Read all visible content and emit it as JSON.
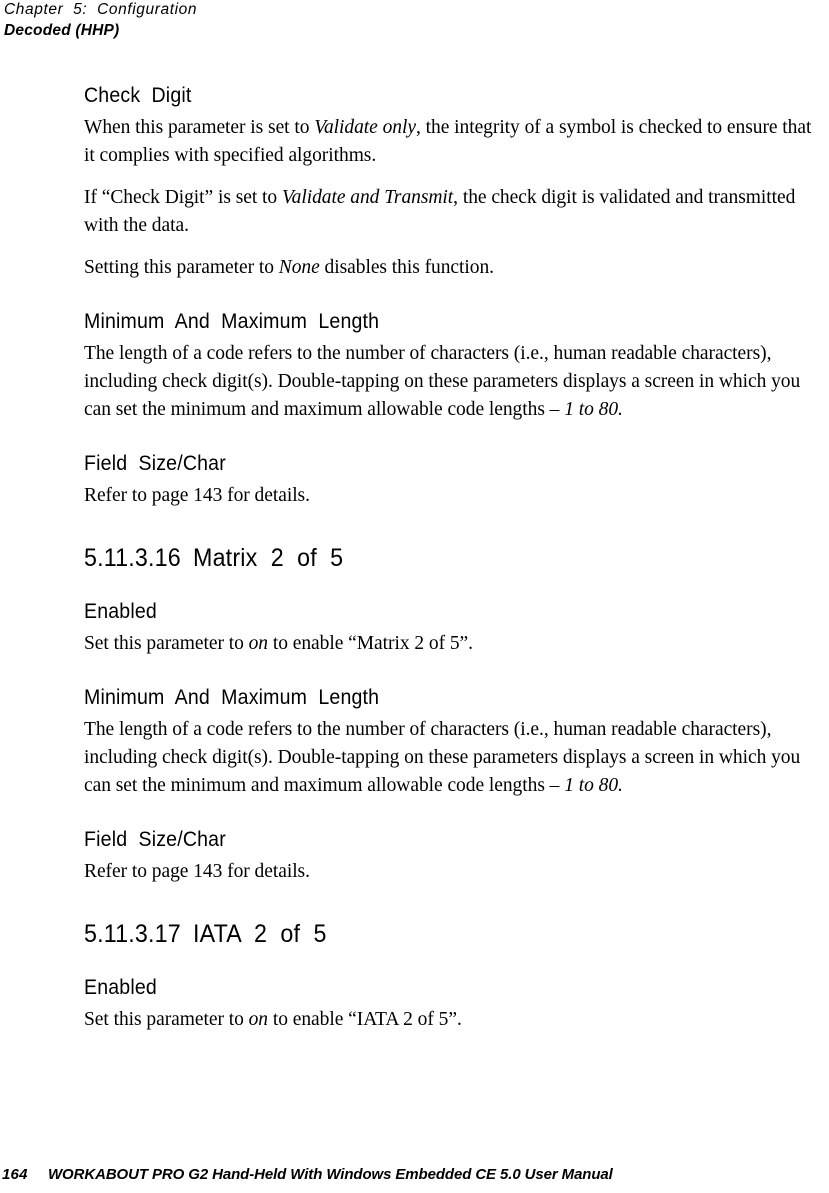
{
  "header": {
    "chapter": "Chapter  5:  Configuration",
    "section": "Decoded (HHP)"
  },
  "footer": {
    "page_number": "164",
    "manual_title": "WORKABOUT PRO G2 Hand-Held With Windows Embedded CE 5.0 User Manual"
  },
  "content": {
    "check_digit": {
      "heading": "Check  Digit",
      "p1_a": "When this parameter is set to ",
      "p1_em": "Validate only",
      "p1_b": ", the integrity of a symbol is checked to ensure that it complies with specified algorithms.",
      "p2_a": "If “Check Digit” is set to ",
      "p2_em": "Validate and Transmit",
      "p2_b": ", the check digit is validated and transmitted with the data.",
      "p3_a": "Setting this parameter to ",
      "p3_em": "None",
      "p3_b": " disables this function."
    },
    "min_max_length_1": {
      "heading": "Minimum  And  Maximum  Length",
      "p1_a": "The length of a code refers to the number of characters (i.e., human readable characters), including check digit(s). Double-tapping on these parameters displays a screen in which you can set the minimum and maximum allowable code lengths – ",
      "p1_em": "1 to 80."
    },
    "field_size_char_1": {
      "heading": "Field  Size/Char",
      "p1": "Refer to page 143 for details."
    },
    "matrix_2_of_5": {
      "number": "5.11.3.16",
      "title": "Matrix  2  of  5",
      "enabled_heading": "Enabled",
      "enabled_p_a": "Set this parameter to ",
      "enabled_p_em": "on",
      "enabled_p_b": " to enable “Matrix 2 of 5”."
    },
    "min_max_length_2": {
      "heading": "Minimum  And  Maximum  Length",
      "p1_a": "The length of a code refers to the number of characters (i.e., human readable characters), including check digit(s). Double-tapping on these parameters displays a screen in which you can set the minimum and maximum allowable code lengths – ",
      "p1_em": "1 to 80."
    },
    "field_size_char_2": {
      "heading": "Field  Size/Char",
      "p1": "Refer to page 143 for details."
    },
    "iata_2_of_5": {
      "number": "5.11.3.17",
      "title": "IATA  2  of  5",
      "enabled_heading": "Enabled",
      "enabled_p_a": "Set this parameter to ",
      "enabled_p_em": "on",
      "enabled_p_b": " to enable “IATA 2 of 5”."
    }
  }
}
